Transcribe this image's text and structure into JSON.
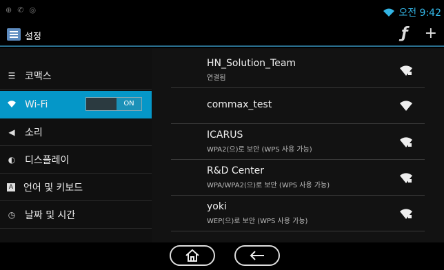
{
  "status_bar": {
    "time": "오전 9:42"
  },
  "action_bar": {
    "title": "설정"
  },
  "left_panel": {
    "items": [
      {
        "label": "코맥스",
        "icon": "list-icon"
      },
      {
        "label": "Wi-Fi",
        "icon": "wifi-icon",
        "toggle": "ON",
        "selected": true
      },
      {
        "label": "소리",
        "icon": "speaker-icon"
      },
      {
        "label": "디스플레이",
        "icon": "brightness-icon"
      },
      {
        "label": "언어 및 키보드",
        "icon": "keyboard-icon"
      },
      {
        "label": "날짜 및 시간",
        "icon": "clock-icon"
      }
    ]
  },
  "networks": [
    {
      "name": "HN_Solution_Team",
      "status": "연결됨"
    },
    {
      "name": "commax_test",
      "status": ""
    },
    {
      "name": "ICARUS",
      "status": "WPA2(으)로 보안 (WPS 사용 가능)"
    },
    {
      "name": "R&D Center",
      "status": "WPA/WPA2(으)로 보안 (WPS 사용 가능)"
    },
    {
      "name": "yoki",
      "status": "WEP(으)로 보안 (WPS 사용 가능)"
    }
  ],
  "colors": {
    "accent": "#0597c8",
    "status_text": "#33b5e5"
  }
}
